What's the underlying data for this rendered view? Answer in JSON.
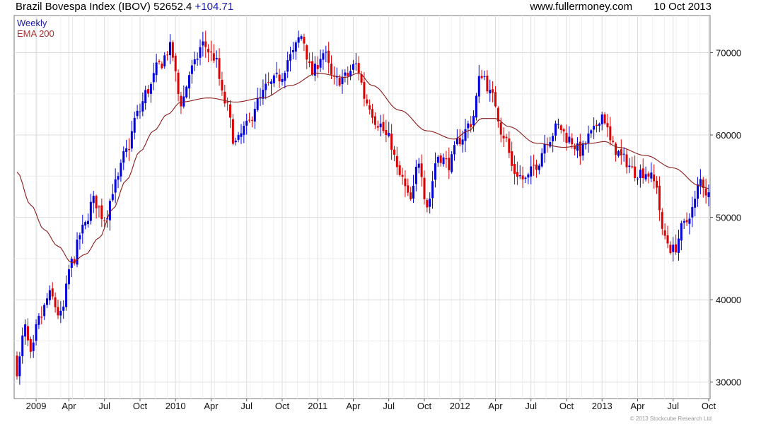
{
  "header": {
    "title": "Brazil Bovespa Index (IBOV)",
    "price": "52652.4",
    "change": "+104.71",
    "website": "www.fullermoney.com",
    "date": "10 Oct 2013"
  },
  "legend": {
    "weekly_label": "Weekly",
    "ema_label": "EMA 200"
  },
  "copyright": "© 2013 Stockcube Research Ltd",
  "colors": {
    "up_bar": "#0000dd",
    "down_bar": "#dd0000",
    "ema_line": "#8b1a1a",
    "grid": "#dcdcdc",
    "axis": "#555555"
  },
  "chart_data": {
    "type": "ohlc_bar",
    "interval": "weekly",
    "ylim": [
      28000,
      74500
    ],
    "y_ticks": [
      30000,
      40000,
      50000,
      60000,
      70000
    ],
    "x_ticks": [
      {
        "label": "2009",
        "week": 7
      },
      {
        "label": "Apr",
        "week": 19
      },
      {
        "label": "Jul",
        "week": 32
      },
      {
        "label": "Oct",
        "week": 45
      },
      {
        "label": "2010",
        "week": 58
      },
      {
        "label": "Apr",
        "week": 71
      },
      {
        "label": "Jul",
        "week": 84
      },
      {
        "label": "Oct",
        "week": 97
      },
      {
        "label": "2011",
        "week": 110
      },
      {
        "label": "Apr",
        "week": 123
      },
      {
        "label": "Jul",
        "week": 136
      },
      {
        "label": "Oct",
        "week": 149
      },
      {
        "label": "2012",
        "week": 162
      },
      {
        "label": "Apr",
        "week": 175
      },
      {
        "label": "Jul",
        "week": 188
      },
      {
        "label": "Oct",
        "week": 201
      },
      {
        "label": "2013",
        "week": 214
      },
      {
        "label": "Apr",
        "week": 227
      },
      {
        "label": "Jul",
        "week": 240
      },
      {
        "label": "Oct",
        "week": 253
      }
    ],
    "close_anchors": [
      [
        0,
        31500
      ],
      [
        3,
        36500
      ],
      [
        5,
        33000
      ],
      [
        8,
        37500
      ],
      [
        12,
        40500
      ],
      [
        16,
        38000
      ],
      [
        20,
        44500
      ],
      [
        24,
        48500
      ],
      [
        28,
        52000
      ],
      [
        32,
        50000
      ],
      [
        36,
        54000
      ],
      [
        40,
        58000
      ],
      [
        44,
        62500
      ],
      [
        48,
        65500
      ],
      [
        52,
        68500
      ],
      [
        56,
        70500
      ],
      [
        60,
        64000
      ],
      [
        64,
        68000
      ],
      [
        68,
        71000
      ],
      [
        72,
        69500
      ],
      [
        76,
        64000
      ],
      [
        80,
        59000
      ],
      [
        84,
        61000
      ],
      [
        88,
        64000
      ],
      [
        92,
        66000
      ],
      [
        96,
        67000
      ],
      [
        100,
        69500
      ],
      [
        104,
        72000
      ],
      [
        108,
        67500
      ],
      [
        112,
        70000
      ],
      [
        116,
        66500
      ],
      [
        120,
        67000
      ],
      [
        124,
        68500
      ],
      [
        128,
        64000
      ],
      [
        132,
        61500
      ],
      [
        136,
        59500
      ],
      [
        140,
        55000
      ],
      [
        144,
        52000
      ],
      [
        147,
        57000
      ],
      [
        150,
        51500
      ],
      [
        154,
        57500
      ],
      [
        158,
        56500
      ],
      [
        162,
        59500
      ],
      [
        166,
        61500
      ],
      [
        170,
        67500
      ],
      [
        174,
        64500
      ],
      [
        178,
        60000
      ],
      [
        182,
        55500
      ],
      [
        186,
        54500
      ],
      [
        190,
        56500
      ],
      [
        194,
        59500
      ],
      [
        198,
        61000
      ],
      [
        202,
        59500
      ],
      [
        206,
        58000
      ],
      [
        210,
        60000
      ],
      [
        214,
        62500
      ],
      [
        218,
        58500
      ],
      [
        222,
        57000
      ],
      [
        226,
        55500
      ],
      [
        230,
        55500
      ],
      [
        234,
        54000
      ],
      [
        236,
        48000
      ],
      [
        240,
        46000
      ],
      [
        244,
        49000
      ],
      [
        247,
        51000
      ],
      [
        250,
        54500
      ],
      [
        253,
        52650
      ]
    ],
    "ema_anchors": [
      [
        0,
        55500
      ],
      [
        5,
        51500
      ],
      [
        10,
        48500
      ],
      [
        15,
        46500
      ],
      [
        20,
        44500
      ],
      [
        25,
        45500
      ],
      [
        30,
        47500
      ],
      [
        35,
        51000
      ],
      [
        40,
        54500
      ],
      [
        45,
        58000
      ],
      [
        50,
        60500
      ],
      [
        55,
        62500
      ],
      [
        60,
        64000
      ],
      [
        70,
        64500
      ],
      [
        80,
        64000
      ],
      [
        90,
        64500
      ],
      [
        100,
        66000
      ],
      [
        110,
        67500
      ],
      [
        120,
        67000
      ],
      [
        125,
        67500
      ],
      [
        130,
        66000
      ],
      [
        140,
        63000
      ],
      [
        150,
        60500
      ],
      [
        160,
        59500
      ],
      [
        165,
        60500
      ],
      [
        170,
        62000
      ],
      [
        175,
        62000
      ],
      [
        180,
        61000
      ],
      [
        190,
        59000
      ],
      [
        200,
        58500
      ],
      [
        210,
        59000
      ],
      [
        215,
        59200
      ],
      [
        220,
        58500
      ],
      [
        230,
        57500
      ],
      [
        240,
        56000
      ],
      [
        250,
        53800
      ],
      [
        253,
        53500
      ]
    ]
  }
}
